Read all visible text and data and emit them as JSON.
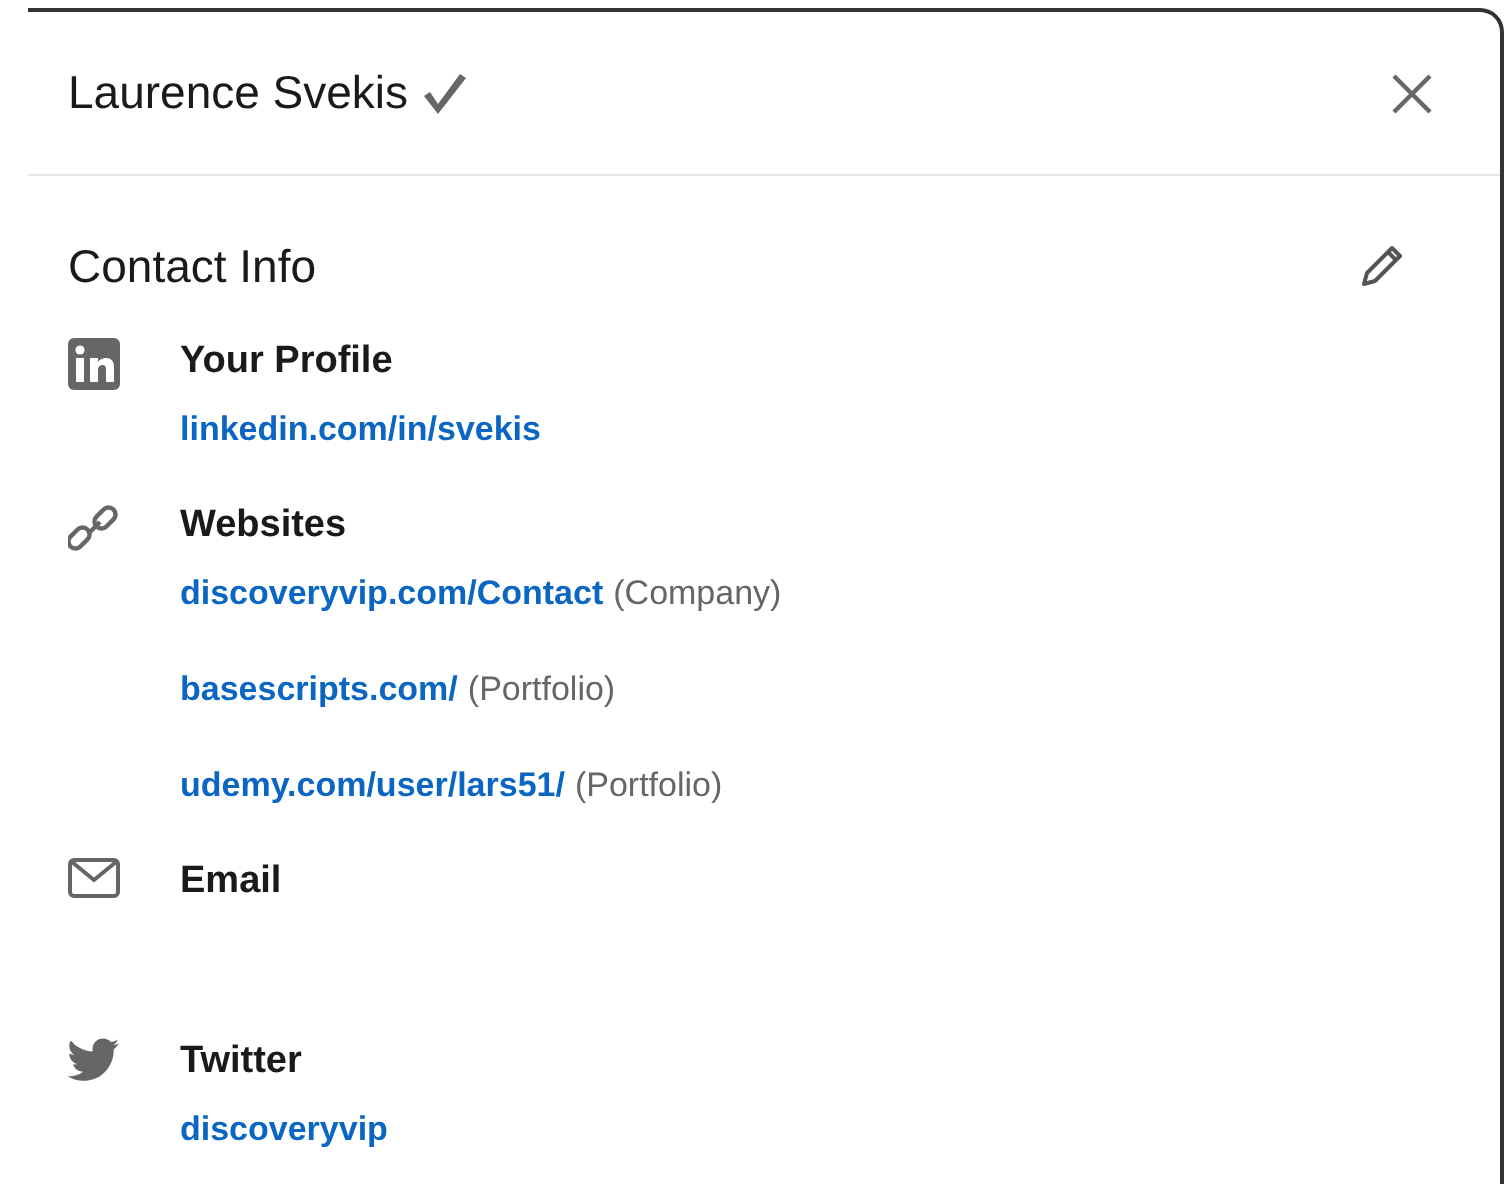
{
  "dialog": {
    "title": "Laurence Svekis",
    "verified": true
  },
  "section": {
    "title": "Contact Info"
  },
  "groups": [
    {
      "kind": "linkedin",
      "label": "Your Profile",
      "links": [
        {
          "url": "linkedin.com/in/svekis"
        }
      ]
    },
    {
      "kind": "link",
      "label": "Websites",
      "links": [
        {
          "url": "discoveryvip.com/Contact",
          "note": "(Company)"
        },
        {
          "url": "basescripts.com/",
          "note": "(Portfolio)"
        },
        {
          "url": "udemy.com/user/lars51/",
          "note": "(Portfolio)"
        }
      ]
    },
    {
      "kind": "email",
      "label": "Email"
    },
    {
      "kind": "twitter",
      "label": "Twitter",
      "links": [
        {
          "url": "discoveryvip"
        }
      ]
    }
  ]
}
